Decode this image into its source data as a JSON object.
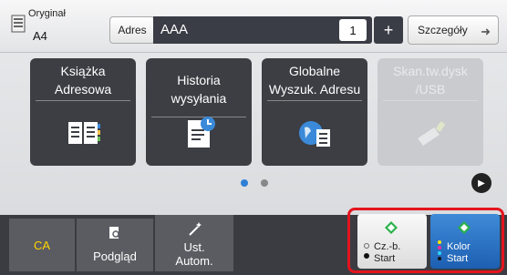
{
  "header": {
    "original_label": "Oryginał",
    "original_value": "A4",
    "address_button": "Adres",
    "address_value": "AAA",
    "address_count": "1",
    "plus_label": "+",
    "details_button": "Szczegóły"
  },
  "tiles": [
    {
      "label": "Książka Adresowa",
      "icon": "address-book-icon"
    },
    {
      "label": "Historia wysyłania",
      "icon": "send-history-icon"
    },
    {
      "label": "Globalne Wyszuk. Adresu",
      "icon": "global-address-search-icon"
    },
    {
      "label": "Skan.tw.dysk /USB",
      "icon": "usb-scan-icon"
    }
  ],
  "pagination": {
    "pages": 2,
    "current": 1
  },
  "bottom": {
    "ca_label": "CA",
    "preview_label": "Podgląd",
    "auto_label": "Ust. Autom.",
    "bw_start_label": "Cz.-b. Start",
    "color_start_label": "Kolor Start"
  },
  "colors": {
    "accent_red": "#e3141d",
    "start_green": "#2ab24a",
    "color_blue": "#2a6fc4"
  }
}
